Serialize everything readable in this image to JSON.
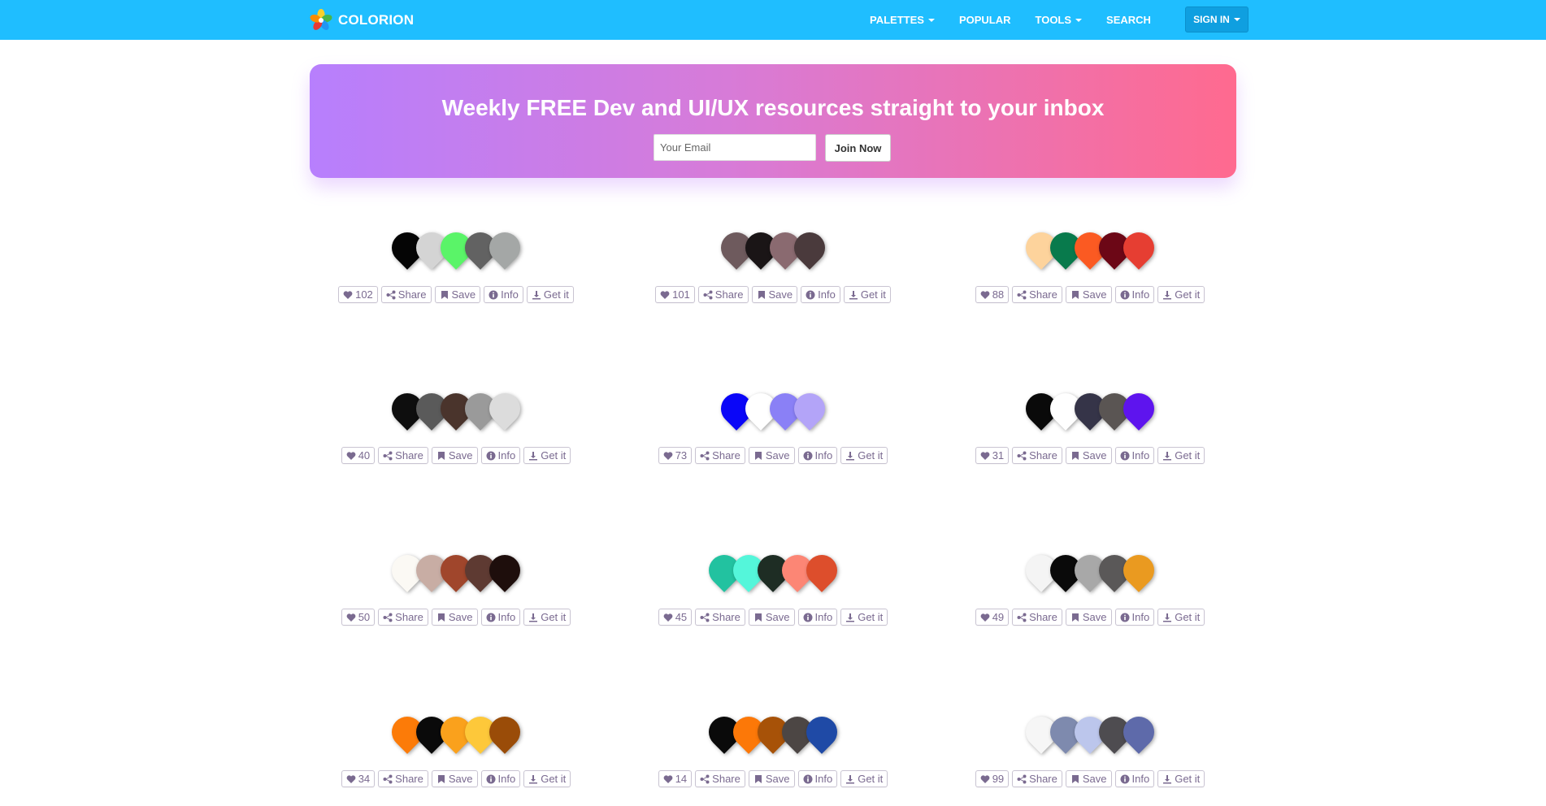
{
  "brand": {
    "name": "COLORION",
    "logo_icon": "flower-logo-icon"
  },
  "nav": {
    "items": [
      {
        "label": "PALETTES",
        "dropdown": true
      },
      {
        "label": "POPULAR",
        "dropdown": false
      },
      {
        "label": "TOOLS",
        "dropdown": true
      },
      {
        "label": "SEARCH",
        "dropdown": false
      }
    ],
    "signin": "SIGN IN"
  },
  "banner": {
    "title": "Weekly FREE Dev and UI/UX resources straight to your inbox",
    "email_placeholder": "Your Email",
    "join_label": "Join Now"
  },
  "actions": {
    "share": "Share",
    "save": "Save",
    "info": "Info",
    "getit": "Get it"
  },
  "colors": {
    "navbar": "#1fbeff",
    "banner_start": "#b77ffd",
    "banner_end": "#ff6a8f",
    "action_text": "#7a6a90"
  },
  "palettes": [
    {
      "likes": "102",
      "colors": [
        "#050505",
        "#d4d4d4",
        "#5af468",
        "#626262",
        "#a4a7a6"
      ]
    },
    {
      "likes": "101",
      "colors": [
        "#6e5a5d",
        "#1a1516",
        "#8a6a70",
        "#4a3a3c"
      ]
    },
    {
      "likes": "88",
      "colors": [
        "#fdd39c",
        "#087a4c",
        "#fb5a22",
        "#6c0716",
        "#e63e32"
      ]
    },
    {
      "likes": "40",
      "colors": [
        "#0e0e0e",
        "#5a5a5a",
        "#4a342c",
        "#9a9a9a",
        "#dcdcdc"
      ]
    },
    {
      "likes": "73",
      "colors": [
        "#0a06f8",
        "#ffffff",
        "#8a80f6",
        "#b3a4f8"
      ]
    },
    {
      "likes": "31",
      "colors": [
        "#0a0a0a",
        "#ffffff",
        "#353448",
        "#5a5553",
        "#5e14ee"
      ]
    },
    {
      "likes": "50",
      "colors": [
        "#fbf9f4",
        "#c8ada4",
        "#a0462c",
        "#5e3a32",
        "#1e0e0c"
      ]
    },
    {
      "likes": "45",
      "colors": [
        "#22c2a0",
        "#54f6da",
        "#1e2d24",
        "#fc8675",
        "#dd4e2c"
      ]
    },
    {
      "likes": "49",
      "colors": [
        "#f4f4f4",
        "#0a0a0a",
        "#a8a8a8",
        "#5a5858",
        "#ea9a20"
      ]
    },
    {
      "likes": "34",
      "colors": [
        "#fc7b08",
        "#0a0a0a",
        "#faa11c",
        "#fdc83a",
        "#9a4c08"
      ]
    },
    {
      "likes": "14",
      "colors": [
        "#0a0a0a",
        "#fc7808",
        "#a75208",
        "#4c4644",
        "#1f4aa6"
      ]
    },
    {
      "likes": "99",
      "colors": [
        "#f6f6f6",
        "#7e8aae",
        "#bcc6ec",
        "#4e4c50",
        "#5e6aaa"
      ]
    }
  ]
}
